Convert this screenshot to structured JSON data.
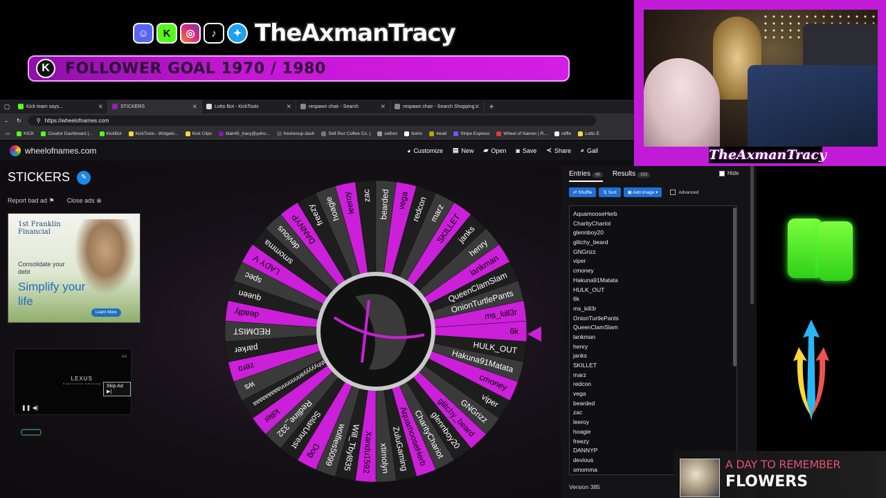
{
  "overlay": {
    "brand": "TheAxmanTracy",
    "social_icons": [
      "discord-icon",
      "kick-icon",
      "instagram-icon",
      "tiktok-icon",
      "twitter-icon"
    ],
    "goal_text": "FOLLOWER GOAL 1970 / 1980",
    "goal_k": "K",
    "cam_name": "TheAxmanTracy"
  },
  "browser": {
    "tabs": [
      {
        "label": "Kick team says...",
        "color": "#53fc18"
      },
      {
        "label": "STICKERS",
        "color": "#8e24aa"
      },
      {
        "label": "Lotto Bot - KickTools",
        "color": "#ddd"
      },
      {
        "label": "respawn chair - Search",
        "color": "#888"
      },
      {
        "label": "respawn chair - Search Shopping",
        "color": "#888"
      }
    ],
    "url": "https://wheelofnames.com",
    "bookmarks": [
      "KICK",
      "Creator Dashboard |...",
      "KickBot",
      "KickTools - Widgets...",
      "Kick Clips",
      "blair45_tracy@yaho...",
      "freshenup dash",
      "Self Rez Coffee Co. |",
      "selfrez",
      "botrix",
      "4wall",
      "Stripe Express",
      "Wheel of Names | R...",
      "raffle",
      "Lotto E"
    ]
  },
  "app": {
    "site_name": "wheelofnames.com",
    "menu": [
      "Customize",
      "New",
      "Open",
      "Save",
      "Share",
      "Gall"
    ],
    "wheel_title": "STICKERS",
    "report_ad": "Report bad ad",
    "close_ads": "Close ads"
  },
  "ad1": {
    "brand": "1st Franklin Financial",
    "small": "Consolidate your debt",
    "big": "Simplify your life",
    "cta": "Learn More"
  },
  "ad2": {
    "brand": "LEXUS",
    "tagline": "Experience Amazing",
    "skip": "Skip Ad ▶|",
    "tag": "Ad"
  },
  "wheel": {
    "names": [
      "6k",
      "HULK_OUT",
      "Hakuna91Matata",
      "cmoney",
      "viper",
      "GNGrizz",
      "glitchy_beard",
      "glennboy20",
      "CharityChariot",
      "AquamooseHerb",
      "ZuluGaming",
      "xtimolyn",
      "Xandu1592",
      "Will_Tbyl835",
      "wolfies5099",
      "Dog",
      "SolarUnrest",
      "Redline_332",
      "killer",
      "hhhhhyyyyyannnnnnnaaaaaaaaa",
      "ws",
      "zero",
      "parker",
      "REDMIST",
      "deadly",
      "queen",
      "spec",
      "LADY V",
      "smomma",
      "devious",
      "DANNYP",
      "freezy",
      "hoagie",
      "leeroy",
      "zac",
      "bearded",
      "vega",
      "redcon",
      "marz",
      "SKILLET",
      "janks",
      "henry",
      "lankman",
      "QueenClamSlam",
      "OnionTurtlePants",
      "ms_kill3r"
    ],
    "colors": [
      "#cc1fd9",
      "#1e1e1e",
      "#3a3a3a"
    ]
  },
  "panel": {
    "entries_label": "Entries",
    "entries_count": "46",
    "results_label": "Results",
    "results_count": "353",
    "hide_label": "Hide",
    "shuffle": "Shuffle",
    "sort": "Sort",
    "add_image": "Add image",
    "advanced": "Advanced",
    "entries": [
      "AquamooseHerb",
      "CharityChariot",
      "glennboy20",
      "glitchy_beard",
      "GNGrizz",
      "viper",
      "cmoney",
      "Hakuna91Matata",
      "HULK_OUT",
      "6k",
      "ms_kill3r",
      "OnionTurtlePants",
      "QueenClamSlam",
      "lankman",
      "henry",
      "janks",
      "SKILLET",
      "marz",
      "redcon",
      "vega",
      "bearded",
      "zac",
      "leeroy",
      "hoagie",
      "freezy",
      "DANNYP",
      "devious",
      "smomma"
    ],
    "version": "Version 385"
  },
  "music": {
    "artist": "A DAY TO REMEMBER",
    "title": "FLOWERS"
  }
}
